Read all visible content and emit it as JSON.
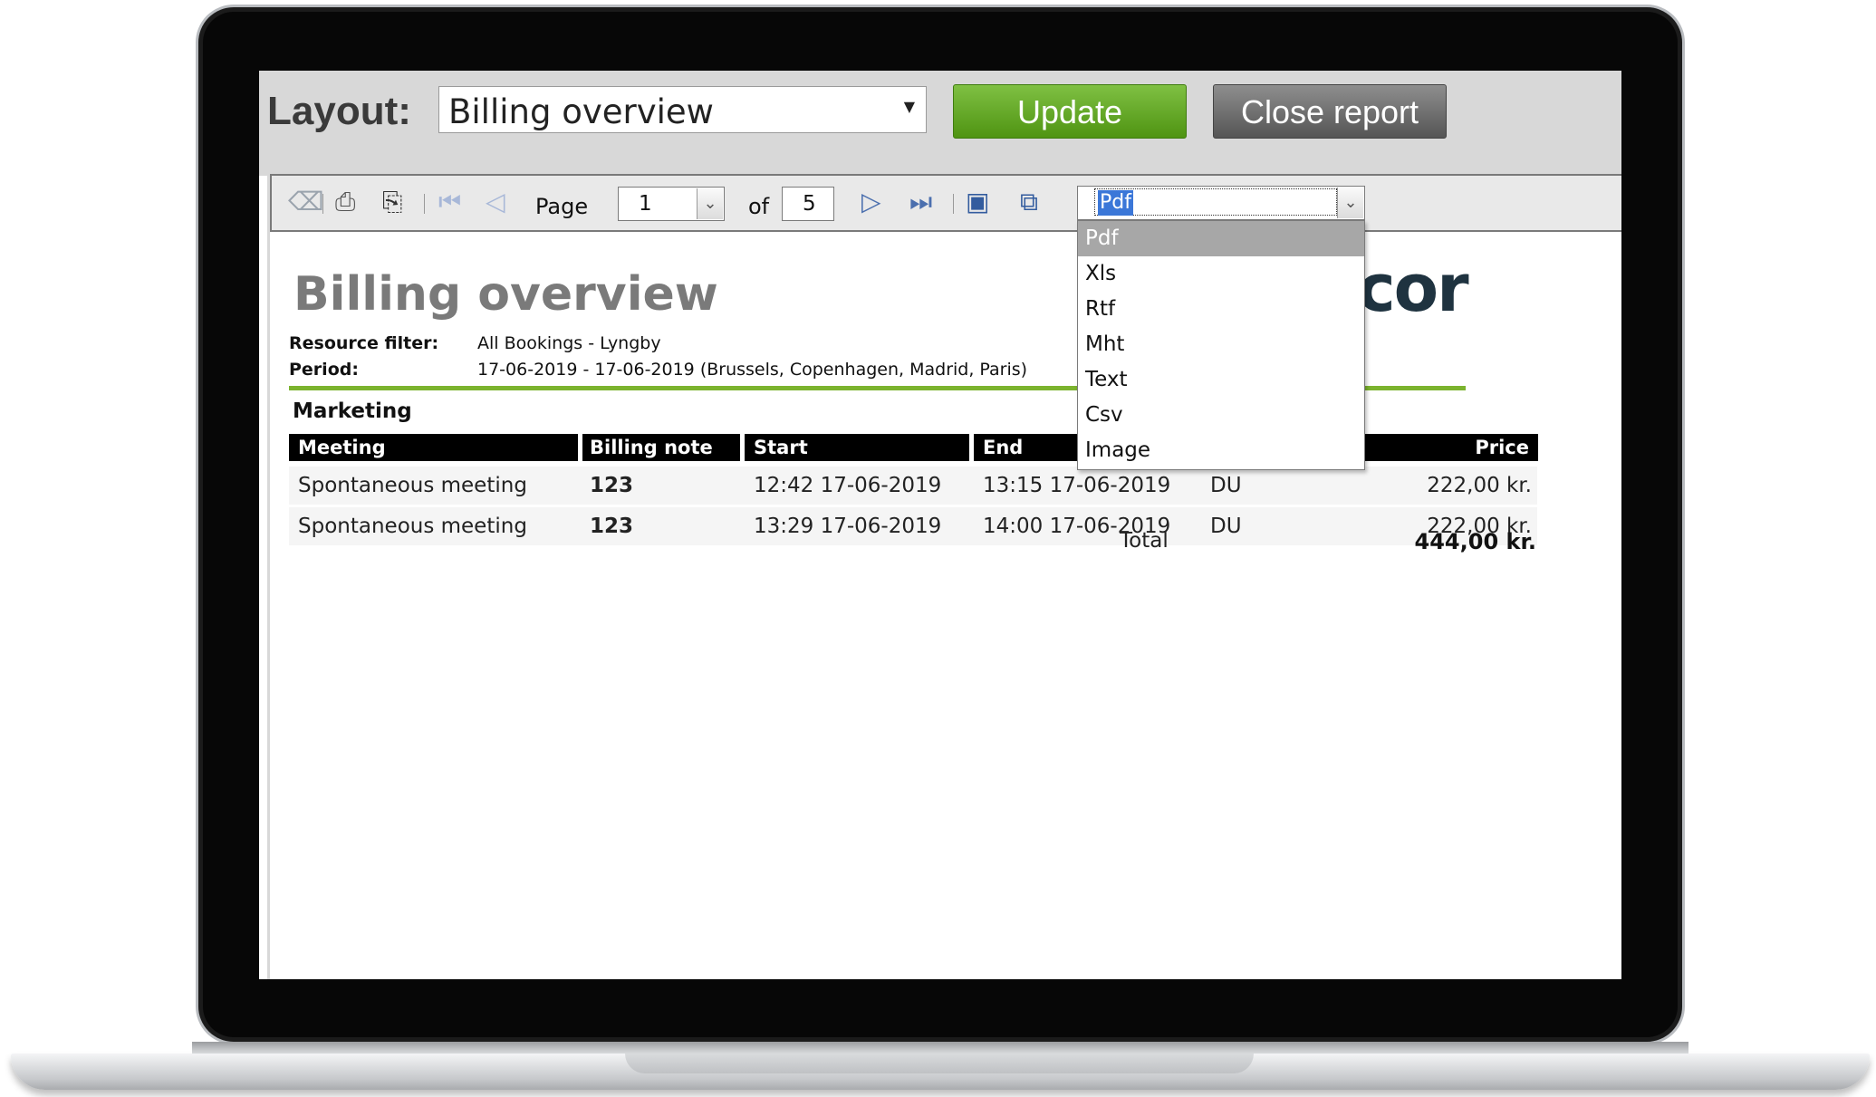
{
  "top_bar": {
    "layout_label": "Layout:",
    "layout_value": "Billing overview",
    "update_label": "Update",
    "close_label": "Close report"
  },
  "toolbar": {
    "page_label": "Page",
    "page_value": "1",
    "of_label": "of",
    "page_count": "5",
    "format_value": "Pdf",
    "format_options": [
      "Pdf",
      "Xls",
      "Rtf",
      "Mht",
      "Text",
      "Csv",
      "Image"
    ]
  },
  "report": {
    "title": "Billing overview",
    "logo_text": "cor",
    "resource_filter_label": "Resource filter:",
    "resource_filter_value": "All Bookings - Lyngby",
    "period_label": "Period:",
    "period_value": "17-06-2019 - 17-06-2019 (Brussels, Copenhagen, Madrid, Paris)",
    "group_title": "Marketing",
    "columns": {
      "meeting": "Meeting",
      "billing_note": "Billing note",
      "start": "Start",
      "end": "End",
      "price": "Price"
    },
    "rows": [
      {
        "meeting": "Spontaneous meeting",
        "billing_note": "123",
        "start": "12:42 17-06-2019",
        "end": "13:15 17-06-2019",
        "unit": "DU",
        "price": "222,00 kr."
      },
      {
        "meeting": "Spontaneous meeting",
        "billing_note": "123",
        "start": "13:29 17-06-2019",
        "end": "14:00 17-06-2019",
        "unit": "DU",
        "price": "222,00 kr."
      }
    ],
    "total_label": "Total",
    "total_value": "444,00 kr."
  },
  "colors": {
    "update_button": "#5aa11a",
    "close_button": "#6e6e6e",
    "accent_rule": "#7bb32e",
    "selection": "#3b77d8"
  }
}
